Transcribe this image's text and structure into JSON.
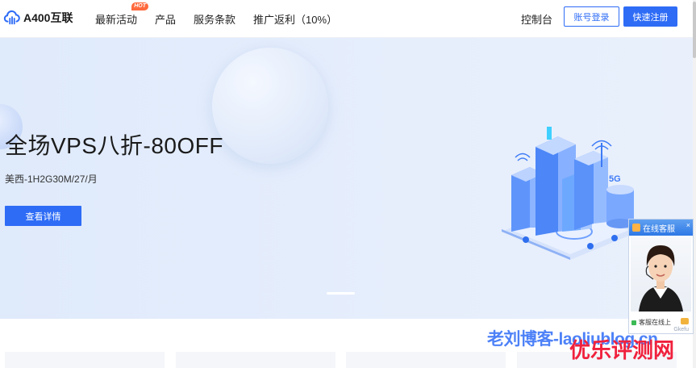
{
  "header": {
    "logo_text": "A400互联",
    "nav": [
      {
        "label": "最新活动",
        "badge": "HOT"
      },
      {
        "label": "产品"
      },
      {
        "label": "服务条款"
      },
      {
        "label": "推广返利（10%）"
      }
    ],
    "console": "控制台",
    "login": "账号登录",
    "register": "快速注册"
  },
  "hero": {
    "title": "全场VPS八折-80OFF",
    "subtitle": "美西-1H2G30M/27/月",
    "button": "查看详情",
    "illustration_label": "5G"
  },
  "chat": {
    "title": "在线客服",
    "close": "×",
    "status": "客服在线上",
    "footer": "Gkefu"
  },
  "watermarks": {
    "blue": "老刘博客-laoliublog.cn",
    "red": "优乐评测网"
  },
  "colors": {
    "accent": "#2e6cf6",
    "hot": "#ff6a3d",
    "watermark_red": "#f0213d"
  },
  "icons": {
    "logo": "cloud-logo-icon",
    "chat_head": "chat-icon",
    "status": "online-status-icon",
    "message": "message-bubble-icon"
  }
}
